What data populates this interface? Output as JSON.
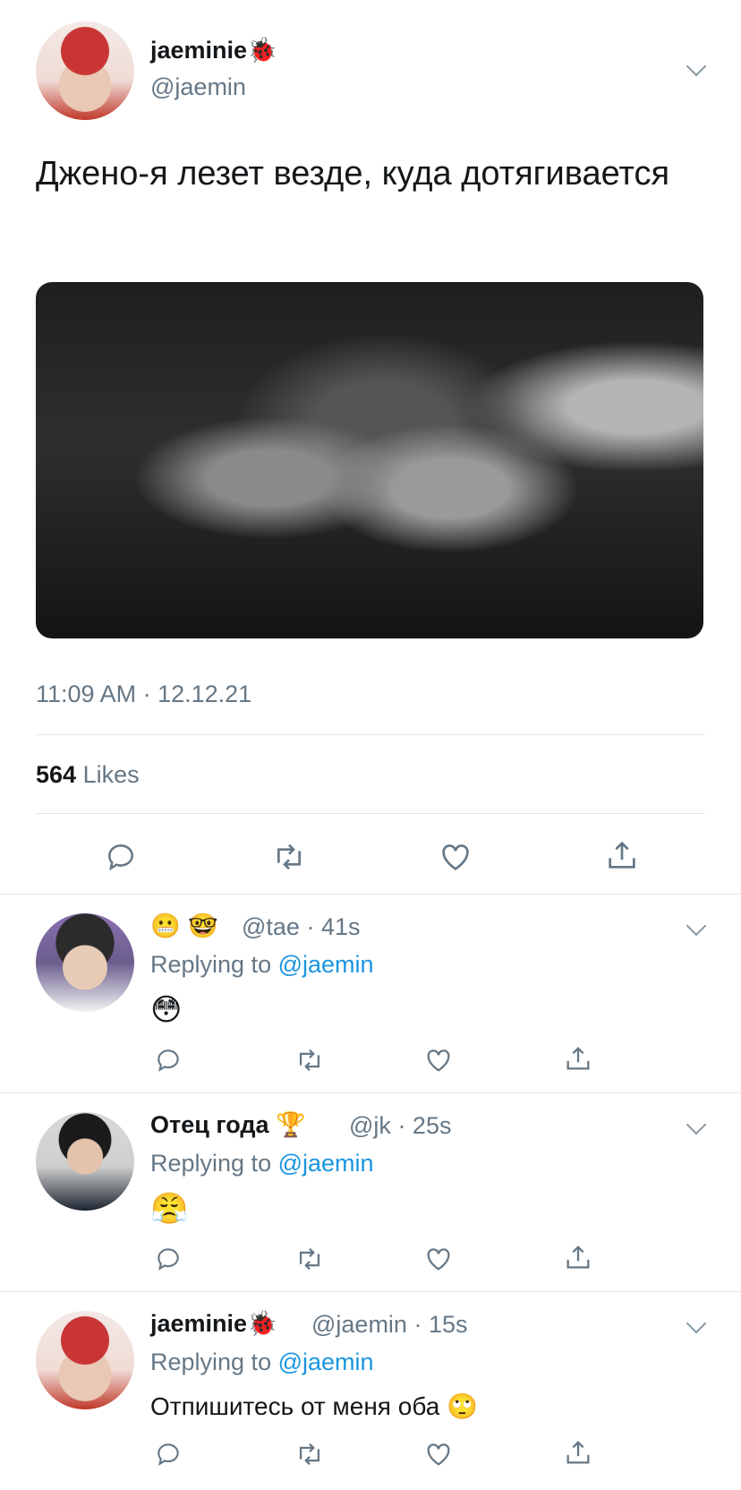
{
  "tweet": {
    "author_name": "jaeminie",
    "author_badge": "🐞",
    "author_handle": "@jaemin",
    "text": "Джено-я лезет везде, куда дотягивается",
    "timestamp": "11:09 AM · 12.12.21",
    "likes_count": "564",
    "likes_label": "Likes"
  },
  "icons": {
    "reply": "reply-icon",
    "retweet": "retweet-icon",
    "like": "heart-icon",
    "share": "share-icon",
    "more": "chevron-down-icon"
  },
  "colors": {
    "text": "#14171a",
    "secondary": "#657786",
    "link": "#1b95e0",
    "divider": "#e1e8ed",
    "icon": "#657786"
  },
  "replies": [
    {
      "name_emojis": "😬 🤓",
      "handle": "@tae",
      "time": "· 41s",
      "replying_label": "Replying to",
      "replying_handle": "@jaemin",
      "body": "😳"
    },
    {
      "name": "Отец года",
      "name_emoji": "🏆",
      "handle": "@jk",
      "time": "· 25s",
      "replying_label": "Replying to",
      "replying_handle": "@jaemin",
      "body": "😤"
    },
    {
      "name": "jaeminie",
      "name_emoji": "🐞",
      "handle": "@jaemin",
      "time": "· 15s",
      "replying_label": "Replying to",
      "replying_handle": "@jaemin",
      "body": "Отпишитесь от меня оба 🙄"
    }
  ]
}
